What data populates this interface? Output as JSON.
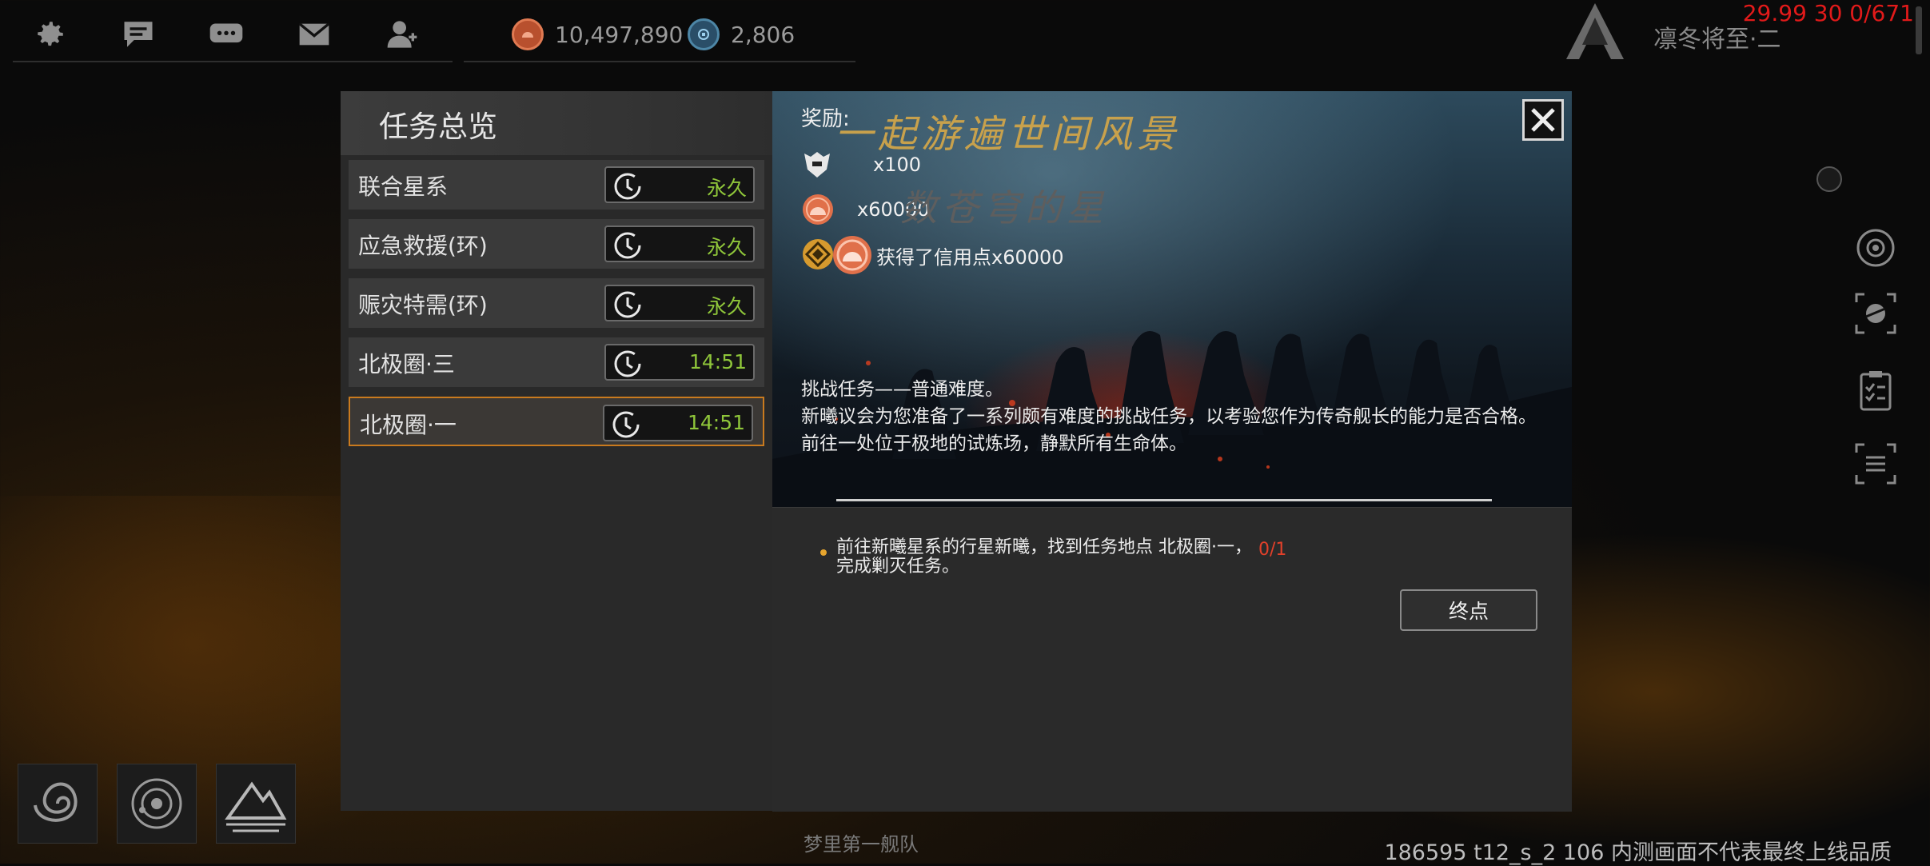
{
  "top_bar": {
    "icons": [
      "gear-icon",
      "chat-icon",
      "message-bubble-icon",
      "mail-icon",
      "friend-icon"
    ],
    "resource_credits": "10,497,890",
    "resource_crystals": "2,806",
    "player_name": "凛冬将至·二",
    "debug_stats": "29.99 30 0/671"
  },
  "dialog": {
    "title": "任务总览",
    "quests": [
      {
        "name": "联合星系",
        "timer": "永久",
        "selected": false
      },
      {
        "name": "应急救援(环)",
        "timer": "永久",
        "selected": false
      },
      {
        "name": "赈灾特需(环)",
        "timer": "永久",
        "selected": false
      },
      {
        "name": "北极圈·三",
        "timer": "14:51",
        "selected": false
      },
      {
        "name": "北极圈·一",
        "timer": "14:51",
        "selected": true
      }
    ],
    "reward_label": "奖励:",
    "rewards": [
      {
        "icon": "fleet-emblem-icon",
        "amount": "x100"
      },
      {
        "icon": "credit-coin-icon",
        "amount": "x60000"
      },
      {
        "icon": "medal-icon",
        "amount": ""
      }
    ],
    "toast_text": "获得了信用点x60000",
    "watermark_line1": "一起游遍世间风景",
    "watermark_line2": "数苍穹的星",
    "description": {
      "line1": "挑战任务——普通难度。",
      "line2": "新曦议会为您准备了一系列颇有难度的挑战任务，以考验您作为传奇舰长的能力是否合格。",
      "line3": "前往一处位于极地的试炼场，静默所有生命体。"
    },
    "objective": {
      "text": "前往新曦星系的行星新曦，找到任务地点 北极圈·一，完成剿灭任务。",
      "progress": "0/1"
    },
    "end_button": "终点"
  },
  "footer": {
    "fleet_name": "梦里第一舰队",
    "build_info": "186595 t12_s_2 106 内测画面不代表最终上线品质"
  },
  "colors": {
    "accent_orange": "#c97a1e",
    "timer_green": "#8fc63a",
    "progress_red": "#e2402a",
    "debug_red": "#e21a1a"
  }
}
